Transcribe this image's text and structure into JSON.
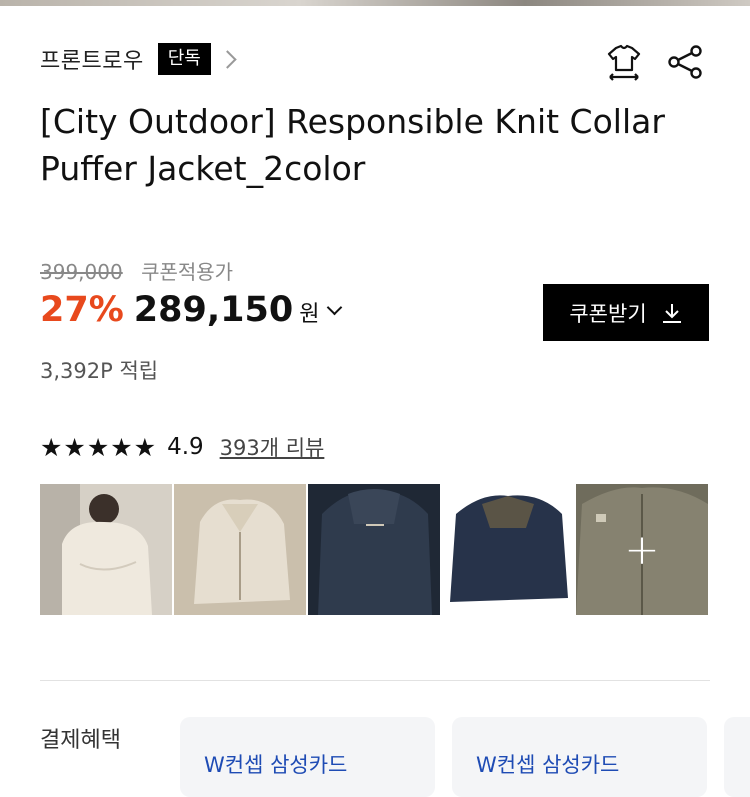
{
  "brand": {
    "name": "프론트로우",
    "badge": "단독"
  },
  "icons": {
    "size_guide": "tshirt-size-icon",
    "share": "share-icon",
    "download": "download-icon",
    "more": "plus-icon"
  },
  "product": {
    "title": "[City Outdoor] Responsible Knit Collar Puffer Jacket_2color"
  },
  "price": {
    "original": "399,000",
    "coupon_note": "쿠폰적용가",
    "discount": "27%",
    "sale": "289,150",
    "currency": "원",
    "discount_color": "#e8491d"
  },
  "coupon_button": {
    "label": "쿠폰받기"
  },
  "points": {
    "text": "3,392P 적립"
  },
  "rating": {
    "stars": "★★★★★",
    "score": "4.9",
    "value": 4.9,
    "review_link": "393개 리뷰"
  },
  "thumbnails": [
    {
      "name": "thumb-1",
      "bg": "#cfc8bd"
    },
    {
      "name": "thumb-2",
      "bg": "#c7bba7"
    },
    {
      "name": "thumb-3",
      "bg": "#2b3647"
    },
    {
      "name": "thumb-4",
      "bg": "#2e3a4e"
    },
    {
      "name": "thumb-5",
      "bg": "#7a7766"
    }
  ],
  "benefits": {
    "label": "결제혜택",
    "cards": [
      {
        "label": "W컨셉 삼성카드"
      },
      {
        "label": "W컨셉 삼성카드"
      }
    ]
  }
}
